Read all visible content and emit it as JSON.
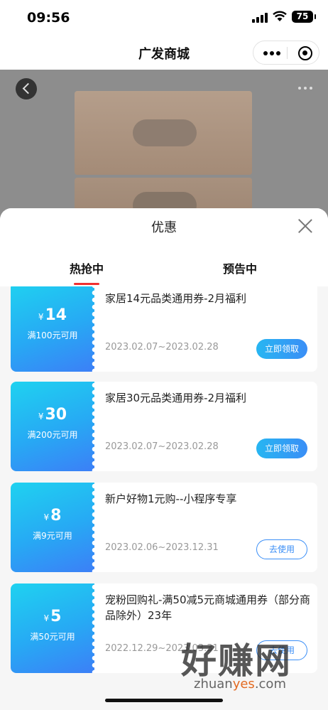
{
  "status": {
    "time": "09:56",
    "battery": "75"
  },
  "nav": {
    "title": "广发商城"
  },
  "sheet": {
    "title": "优惠",
    "tabs": [
      {
        "label": "热抢中",
        "active": true
      },
      {
        "label": "预告中",
        "active": false
      }
    ]
  },
  "coupons": [
    {
      "currency": "¥",
      "amount": "14",
      "condition": "满100元可用",
      "title": "家居14元品类通用券-2月福利",
      "date": "2023.02.07~2023.02.28",
      "button": "立即领取",
      "button_type": "claim"
    },
    {
      "currency": "¥",
      "amount": "30",
      "condition": "满200元可用",
      "title": "家居30元品类通用券-2月福利",
      "date": "2023.02.07~2023.02.28",
      "button": "立即领取",
      "button_type": "claim"
    },
    {
      "currency": "¥",
      "amount": "8",
      "condition": "满9元可用",
      "title": "新户好物1元购--小程序专享",
      "date": "2023.02.06~2023.12.31",
      "button": "去使用",
      "button_type": "use"
    },
    {
      "currency": "¥",
      "amount": "5",
      "condition": "满50元可用",
      "title": "宠粉回购礼-满50减5元商城通用券（部分商品除外）23年",
      "date": "2022.12.29~2023.03.31",
      "button": "去使用",
      "button_type": "use"
    }
  ],
  "watermark": {
    "main": "好赚网",
    "url_prefix": "zhuan",
    "url_highlight": "yes",
    "url_suffix": ".com"
  },
  "colors": {
    "accent": "#3a8ef6",
    "coupon_gradient_start": "#1fd2f0",
    "tab_underline": "#f23030"
  },
  "icons": [
    "signal-icon",
    "wifi-icon",
    "battery-icon",
    "more-dots-icon",
    "close-target-icon",
    "back-icon",
    "close-icon"
  ]
}
